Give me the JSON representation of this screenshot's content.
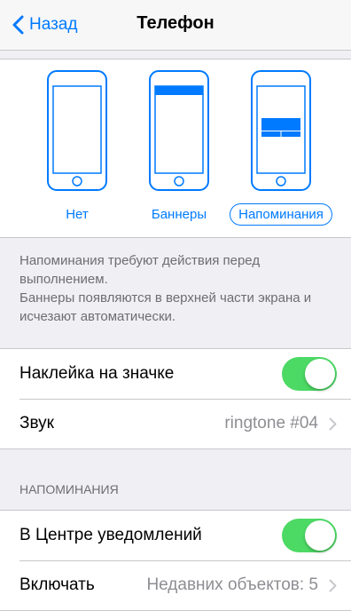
{
  "nav": {
    "back_label": "Назад",
    "title": "Телефон"
  },
  "styles": {
    "options": [
      {
        "label": "Нет"
      },
      {
        "label": "Баннеры"
      },
      {
        "label": "Напоминания",
        "selected": true
      }
    ]
  },
  "footer": {
    "line1": "Напоминания требуют действия перед выполнением.",
    "line2": "Баннеры появляются в верхней части экрана и исчезают автоматически."
  },
  "rows": {
    "badge": {
      "label": "Наклейка на значке",
      "on": true
    },
    "sound": {
      "label": "Звук",
      "value": "ringtone #04"
    }
  },
  "alerts_section": {
    "header": "НАПОМИНАНИЯ",
    "notification_center": {
      "label": "В Центре уведомлений",
      "on": true
    },
    "include": {
      "label": "Включать",
      "value": "Недавних объектов: 5"
    }
  },
  "colors": {
    "accent": "#007aff",
    "toggle_on": "#4cd964",
    "secondary_text": "#8e8e93"
  },
  "icons": [
    "chevron-left-icon",
    "phone-none-icon",
    "phone-banner-icon",
    "phone-alert-icon",
    "chevron-right-icon"
  ]
}
